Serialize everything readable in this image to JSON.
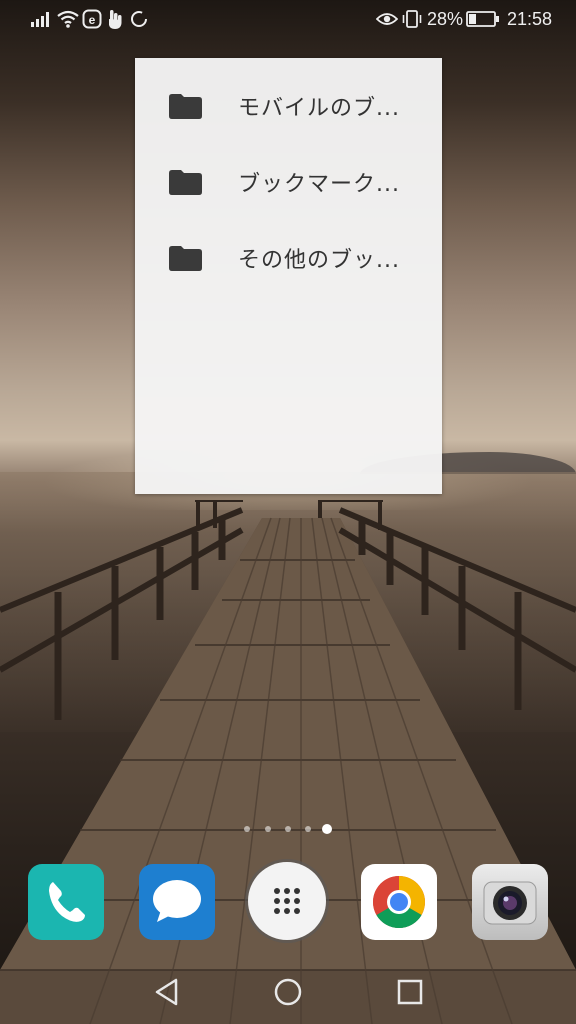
{
  "status_bar": {
    "battery_percent": "28%",
    "time": "21:58",
    "icons": [
      "signal-icon",
      "wifi-icon",
      "e-app-icon",
      "hand-icon",
      "loading-icon",
      "eye-icon",
      "vibrate-icon",
      "battery-icon"
    ]
  },
  "bookmark_widget": {
    "items": [
      {
        "label": "モバイルのブ...",
        "icon": "folder-icon"
      },
      {
        "label": "ブックマーク...",
        "icon": "folder-icon"
      },
      {
        "label": "その他のブッ...",
        "icon": "folder-icon"
      }
    ]
  },
  "page_indicator": {
    "pages": 5,
    "current": 5,
    "first_icon": "home-dot"
  },
  "dock": {
    "apps": [
      {
        "name": "phone-app",
        "icon": "phone-icon",
        "color": "#1bb6b0"
      },
      {
        "name": "messages-app",
        "icon": "message-bubble-icon",
        "color": "#1e7fd0"
      },
      {
        "name": "app-drawer",
        "icon": "grid-icon",
        "color": "#f3f3f3"
      },
      {
        "name": "chrome-app",
        "icon": "chrome-icon",
        "color": "#ffffff"
      },
      {
        "name": "camera-app",
        "icon": "camera-icon",
        "color": "#dadada"
      }
    ]
  },
  "nav_bar": {
    "buttons": [
      "back-icon",
      "home-icon",
      "recents-icon"
    ]
  },
  "colors": {
    "widget_bg": "#f5f5f5",
    "folder": "#3a3a3a",
    "text": "#333333"
  }
}
